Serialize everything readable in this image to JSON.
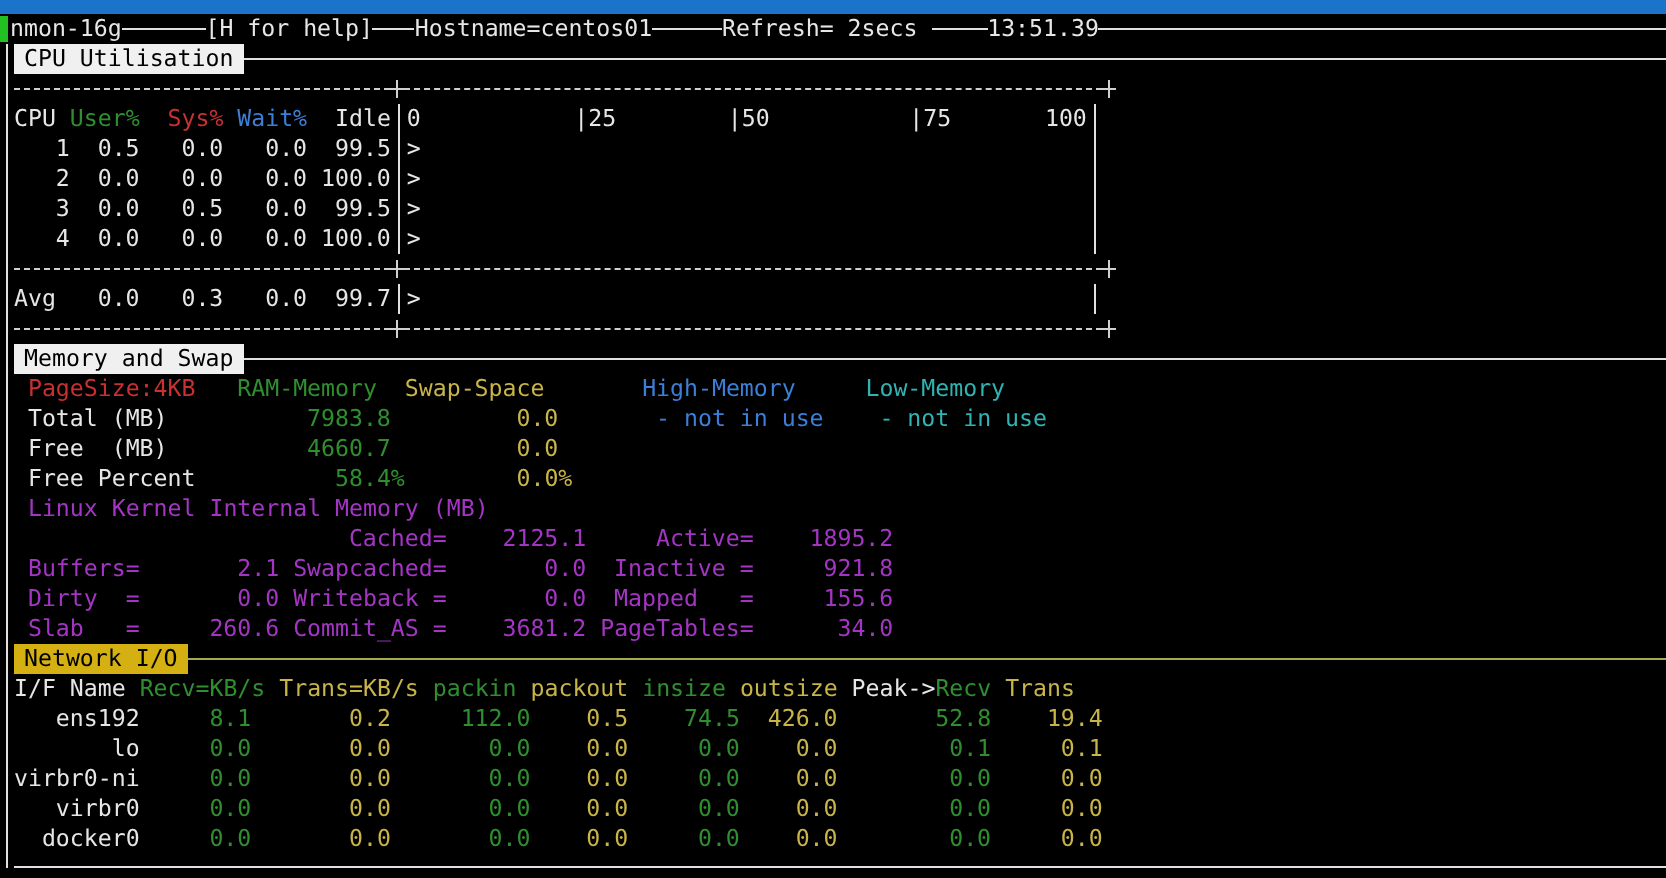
{
  "header": {
    "program": "nmon-16g",
    "help": "[H for help]",
    "hostname": "Hostname=centos01",
    "refresh": "Refresh= 2secs",
    "time": "13:51.39"
  },
  "cpu": {
    "title": "CPU Utilisation",
    "columns": [
      "CPU",
      "User%",
      "Sys%",
      "Wait%",
      "Idle"
    ],
    "scale": [
      "0",
      "|25",
      "|50",
      "|75",
      "100"
    ],
    "rows": [
      {
        "cpu": "1",
        "user": "0.5",
        "sys": "0.0",
        "wait": "0.0",
        "idle": "99.5",
        "bar": ">"
      },
      {
        "cpu": "2",
        "user": "0.0",
        "sys": "0.0",
        "wait": "0.0",
        "idle": "100.0",
        "bar": ">"
      },
      {
        "cpu": "3",
        "user": "0.0",
        "sys": "0.5",
        "wait": "0.0",
        "idle": "99.5",
        "bar": ">"
      },
      {
        "cpu": "4",
        "user": "0.0",
        "sys": "0.0",
        "wait": "0.0",
        "idle": "100.0",
        "bar": ">"
      }
    ],
    "average": {
      "label": "Avg",
      "user": "0.0",
      "sys": "0.3",
      "wait": "0.0",
      "idle": "99.7",
      "bar": ">"
    }
  },
  "memory": {
    "title": "Memory and Swap",
    "columns": [
      "PageSize:4KB",
      "RAM-Memory",
      "Swap-Space",
      "High-Memory",
      "Low-Memory"
    ],
    "rows": [
      {
        "kind": "amount",
        "label": "Total (MB)",
        "ram": "7983.8",
        "swap": "0.0",
        "high": "- not in use",
        "low": "- not in use"
      },
      {
        "kind": "amount",
        "label": "Free  (MB)",
        "ram": "4660.7",
        "swap": "0.0"
      },
      {
        "kind": "percent",
        "label": "Free Percent",
        "ram": "58.4%",
        "swap": "0.0%"
      }
    ],
    "kernel_title": "Linux Kernel Internal Memory (MB)",
    "kernel_rows": [
      [
        null,
        {
          "label": "Cached=",
          "value": "2125.1"
        },
        {
          "label": "Active=",
          "value": "1895.2"
        }
      ],
      [
        {
          "label": "Buffers=",
          "value": "2.1"
        },
        {
          "label": "Swapcached=",
          "value": "0.0"
        },
        {
          "label": "Inactive =",
          "value": "921.8"
        }
      ],
      [
        {
          "label": "Dirty  =",
          "value": "0.0"
        },
        {
          "label": "Writeback =",
          "value": "0.0"
        },
        {
          "label": "Mapped   =",
          "value": "155.6"
        }
      ],
      [
        {
          "label": "Slab   =",
          "value": "260.6"
        },
        {
          "label": "Commit_AS =",
          "value": "3681.2"
        },
        {
          "label": "PageTables=",
          "value": "34.0"
        }
      ]
    ]
  },
  "network": {
    "title": "Network I/O",
    "columns": [
      "I/F Name",
      "Recv=KB/s",
      "Trans=KB/s",
      "packin",
      "packout",
      "insize",
      "outsize",
      "Peak->",
      "Recv",
      "Trans"
    ],
    "rows": [
      {
        "name": "ens192",
        "values": [
          "8.1",
          "0.2",
          "112.0",
          "0.5",
          "74.5",
          "426.0",
          "52.8",
          "19.4"
        ]
      },
      {
        "name": "lo",
        "values": [
          "0.0",
          "0.0",
          "0.0",
          "0.0",
          "0.0",
          "0.0",
          "0.1",
          "0.1"
        ]
      },
      {
        "name": "virbr0-ni",
        "values": [
          "0.0",
          "0.0",
          "0.0",
          "0.0",
          "0.0",
          "0.0",
          "0.0",
          "0.0"
        ]
      },
      {
        "name": "virbr0",
        "values": [
          "0.0",
          "0.0",
          "0.0",
          "0.0",
          "0.0",
          "0.0",
          "0.0",
          "0.0"
        ]
      },
      {
        "name": "docker0",
        "values": [
          "0.0",
          "0.0",
          "0.0",
          "0.0",
          "0.0",
          "0.0",
          "0.0",
          "0.0"
        ]
      }
    ]
  }
}
